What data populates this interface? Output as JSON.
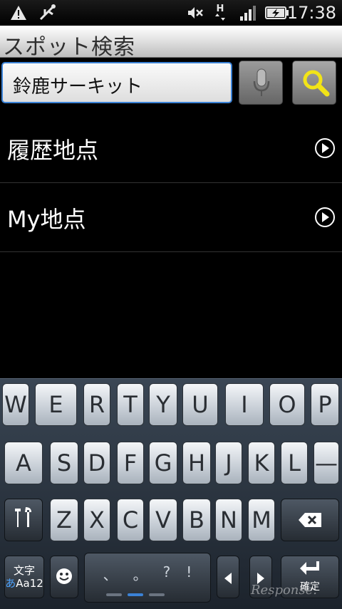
{
  "status_bar": {
    "time": "17:38",
    "icons": [
      "warning-icon",
      "usb-icon",
      "mute-icon",
      "hspa-data-icon",
      "signal-icon",
      "battery-charging-icon"
    ],
    "network_label": "H"
  },
  "title_bar": {
    "title": "スポット検索"
  },
  "search": {
    "value": "鈴鹿サーキット"
  },
  "list": {
    "items": [
      {
        "label": "履歴地点"
      },
      {
        "label": "My地点"
      }
    ]
  },
  "keyboard": {
    "row1": [
      "W",
      "E",
      "R",
      "T",
      "Y",
      "U",
      "I",
      "O",
      "P"
    ],
    "row2": [
      "A",
      "S",
      "D",
      "F",
      "G",
      "H",
      "J",
      "K",
      "L",
      "—"
    ],
    "row3": [
      "Z",
      "X",
      "C",
      "V",
      "B",
      "N",
      "M"
    ],
    "mode_key": {
      "line1": "文字",
      "kana": "あ",
      "alpha": "Aa12"
    },
    "space_symbols": [
      "、",
      "。",
      "?",
      "!"
    ],
    "enter_label": "確定",
    "accent": "#3b82d6"
  },
  "watermark": "Response."
}
